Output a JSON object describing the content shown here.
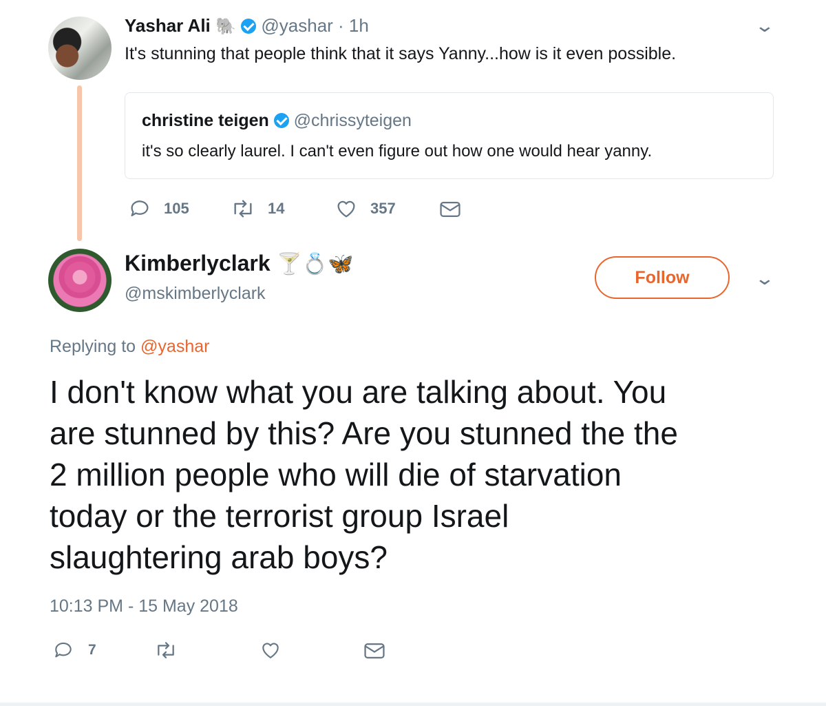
{
  "tweet": {
    "author_name": "Yashar Ali",
    "author_emoji": "🐘",
    "author_handle": "@yashar",
    "time": "· 1h",
    "text": "It's stunning that people think that it says Yanny...how is it even possible.",
    "quoted": {
      "author_name": "christine teigen",
      "author_handle": "@chrissyteigen",
      "text": "it's so clearly laurel. I can't even figure out how one would hear yanny."
    },
    "actions": {
      "replies": "105",
      "retweets": "14",
      "likes": "357"
    }
  },
  "reply": {
    "author_name": "Kimberlyclark",
    "author_emojis": "🍸💍🦋",
    "author_handle": "@mskimberlyclark",
    "follow_label": "Follow",
    "replying_to_prefix": "Replying to",
    "replying_to_handle": "@yashar",
    "lines": [
      "I don't know what you are talking about. You",
      "are stunned by this? Are you stunned the the",
      "2 million people who will die of starvation",
      "today or the terrorist group Israel",
      "slaughtering arab boys?"
    ],
    "timestamp": "10:13 PM - 15 May 2018",
    "actions": {
      "replies": "7"
    }
  },
  "colors": {
    "accent": "#e8652e",
    "verified": "#1da1f2",
    "muted": "#657786",
    "thread_line": "#f7c5a9",
    "border": "#e1e8ed"
  },
  "icons": [
    "avatar",
    "verified-icon",
    "chevron-down-icon",
    "reply-icon",
    "retweet-icon",
    "like-icon",
    "message-icon",
    "elephant-emoji",
    "cocktail-emoji",
    "ring-emoji",
    "butterfly-emoji"
  ]
}
